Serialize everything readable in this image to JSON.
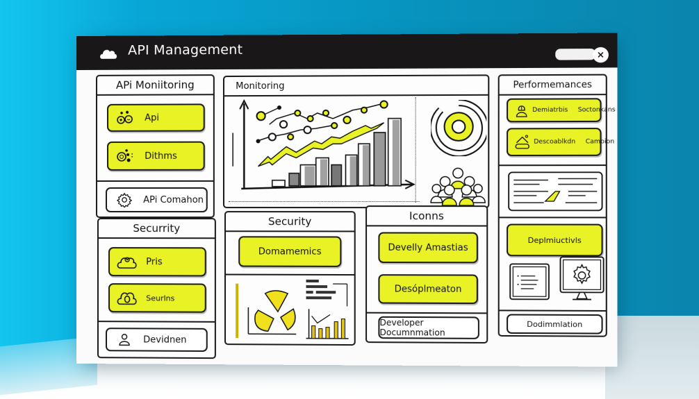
{
  "window": {
    "title": "API Management",
    "title_icon": "cloud-icon",
    "close_icon": "close-icon",
    "close_glyph": "×",
    "search_placeholder": ""
  },
  "colors": {
    "accent_yellow": "#e9f224",
    "titlebar": "#1a1718",
    "background_blue": "#0793be",
    "ink": "#1b1b1b"
  },
  "left_column": {
    "api_monitoring": {
      "header": "APi Moniitoring",
      "items": [
        {
          "label": "Api",
          "icon": "gears-cluster-icon"
        },
        {
          "label": "Dithms",
          "icon": "settings-cluster-icon"
        }
      ],
      "footer_button": {
        "label": "APi Comahon",
        "icon": "gear-icon"
      }
    },
    "security": {
      "header": "Securrity",
      "items": [
        {
          "label": "Pris",
          "icon": "cloud-user-icon"
        },
        {
          "label": "Seurlns",
          "icon": "cloud-lock-icon"
        }
      ],
      "footer_button": {
        "label": "Devidnen",
        "icon": "user-icon"
      }
    }
  },
  "monitoring": {
    "header": "Monitoring",
    "chart_icon": "bar-line-chart-icon",
    "donut_icon": "donut-chart-icon",
    "people_icon": "user-group-icon"
  },
  "security_panel": {
    "header": "Security",
    "button": "Domamemics",
    "pie_icon": "pie-chart-icon",
    "mini_chart_icon": "mini-bar-chart-icon"
  },
  "icons_panel": {
    "header": "Iconns",
    "buttons": [
      "Develly Amastias",
      "Desóplmeaton"
    ],
    "footer_button": "Developer Documnmation"
  },
  "right_column": {
    "header": "Performemances",
    "items": [
      {
        "label": "Demiatrbis",
        "label2": "Soctonkans",
        "icon": "user-badge-icon"
      },
      {
        "label": "Descoablkdn",
        "label2": "Cambion",
        "icon": "cloud-house-icon"
      }
    ],
    "document_icon": "text-document-icon",
    "button": "Deplmiuctivls",
    "list_icon": "list-window-icon",
    "monitor_icon": "monitor-gear-icon",
    "footer_button": "Dodimmlation"
  }
}
